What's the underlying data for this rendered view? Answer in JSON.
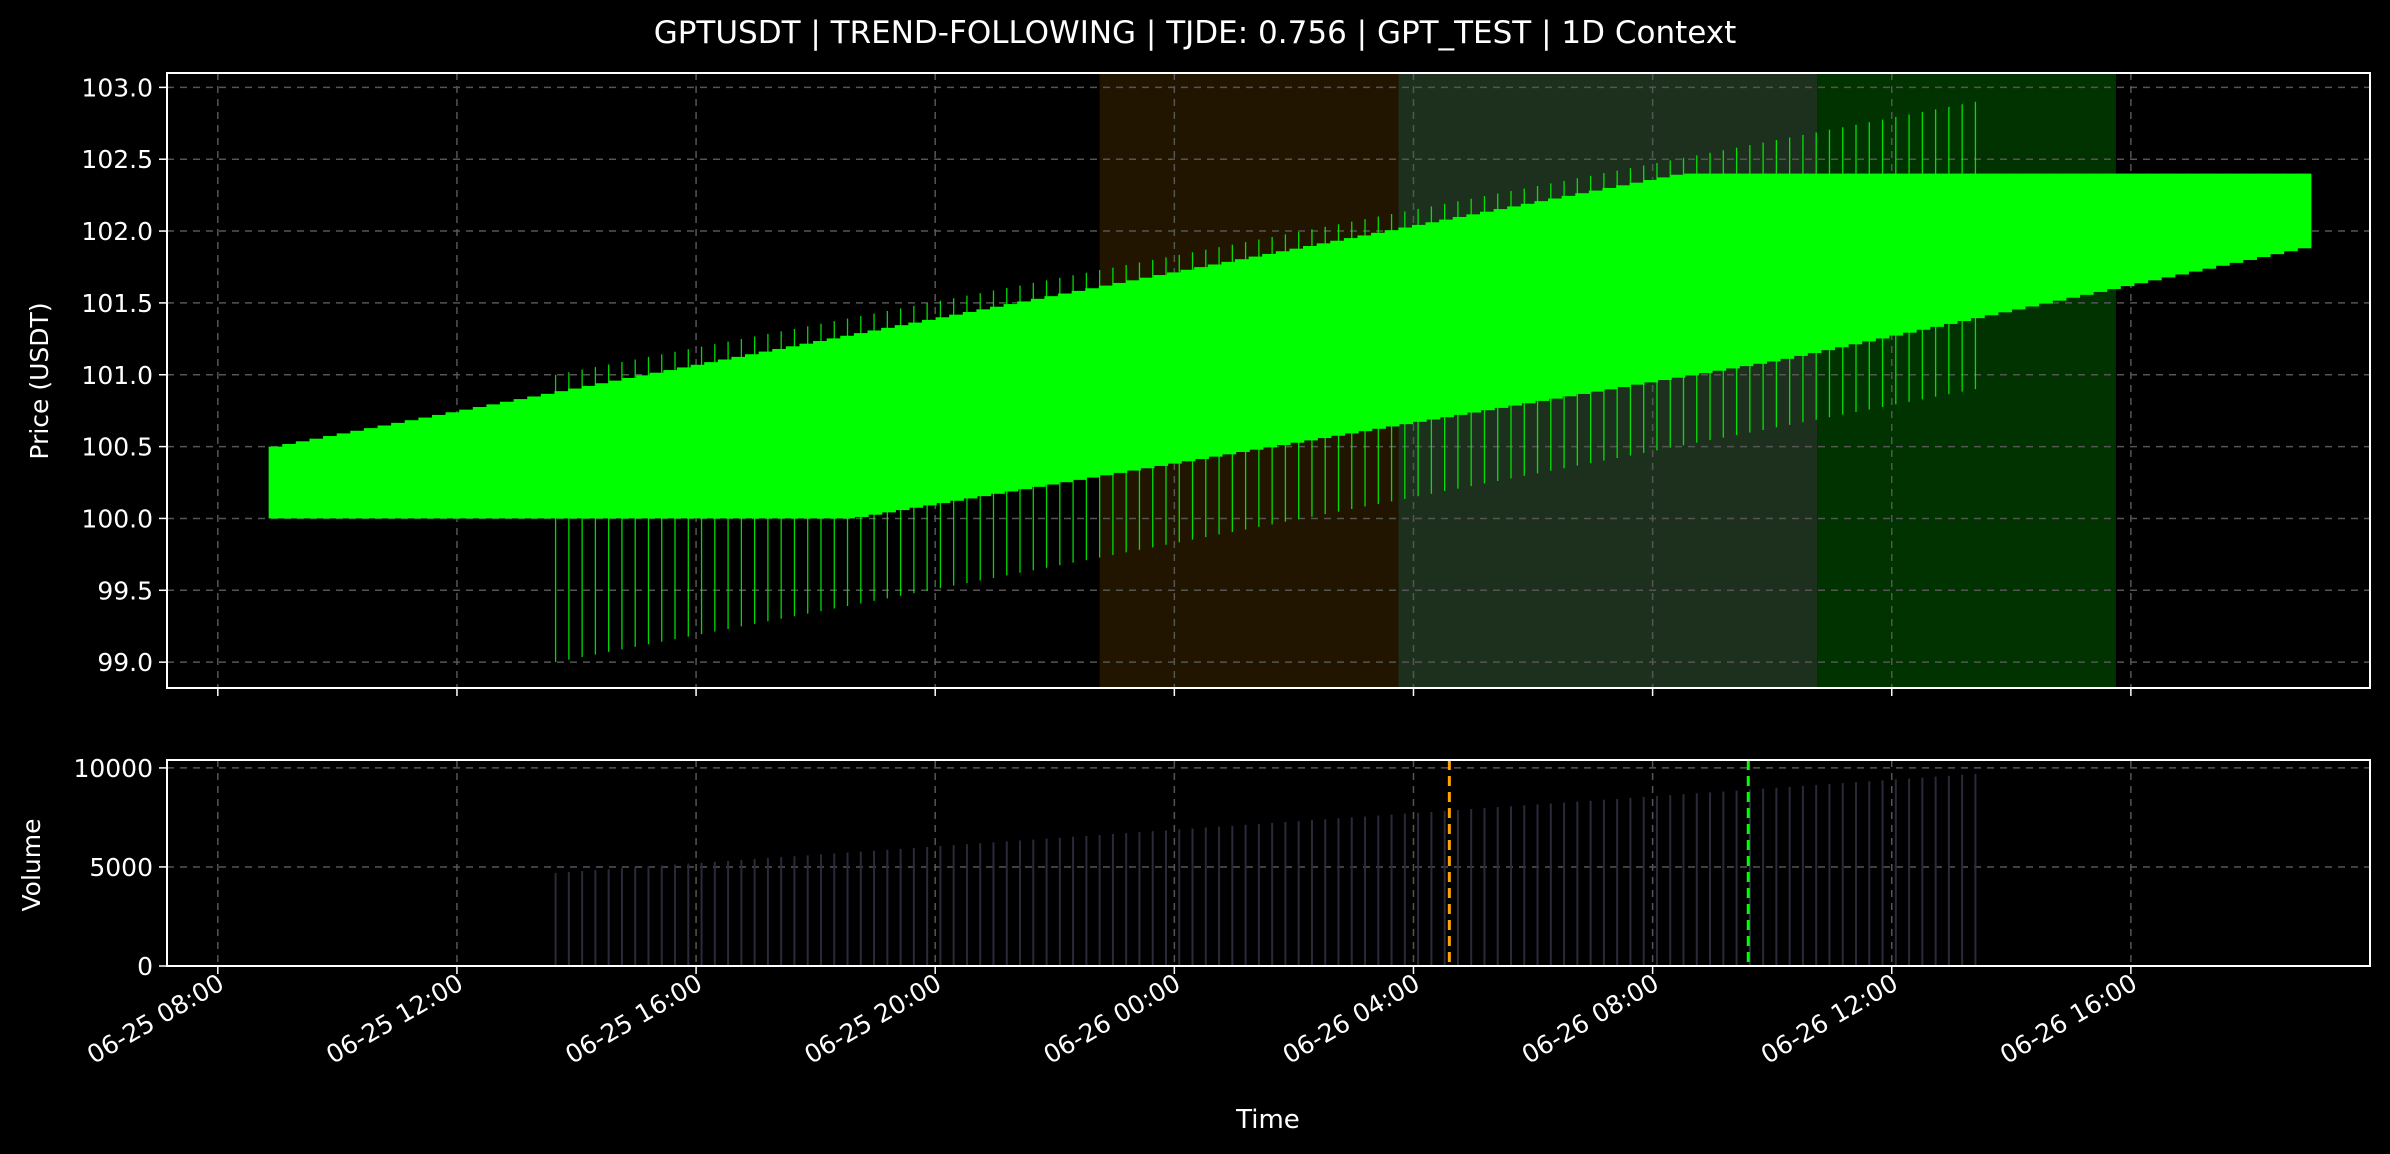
{
  "chart_data": {
    "type": "candlestick",
    "title": "GPTUSDT | TREND-FOLLOWING | TJDE: 0.756 | GPT_TEST | 1D Context",
    "x_tick_labels": [
      "06-25 08:00",
      "06-25 12:00",
      "06-25 16:00",
      "06-25 20:00",
      "06-26 00:00",
      "06-26 04:00",
      "06-26 08:00",
      "06-26 12:00",
      "06-26 16:00"
    ],
    "x_axis_label": "Time",
    "x_range_hours": [
      -0.85,
      36.0
    ],
    "price_panel": {
      "ylabel": "Price (USDT)",
      "ylim": [
        98.82,
        103.1
      ],
      "yticks": [
        99.0,
        99.5,
        100.0,
        100.5,
        101.0,
        101.5,
        102.0,
        102.5,
        103.0
      ],
      "candle_color": "#00ff00",
      "body": {
        "bottom": [
          [
            0.85,
            100.0
          ],
          [
            10.5,
            100.0
          ],
          [
            26.0,
            101.1
          ],
          [
            35.0,
            101.9
          ]
        ],
        "top": [
          [
            0.85,
            100.5
          ],
          [
            24.4,
            102.4
          ],
          [
            35.0,
            102.4
          ]
        ]
      },
      "wicks": {
        "start_hour": 5.65,
        "end_hour": 29.4,
        "count": 108,
        "low_start": 99.0,
        "low_end": 100.9,
        "high_start": 101.0,
        "high_end": 102.9
      },
      "shaded_regions": [
        {
          "from_hour": 14.75,
          "to_hour": 19.75,
          "color": "#ffa500",
          "opacity": 0.13
        },
        {
          "from_hour": 19.75,
          "to_hour": 26.75,
          "color": "#90ee90",
          "opacity": 0.2
        },
        {
          "from_hour": 26.75,
          "to_hour": 31.75,
          "color": "#00ff00",
          "opacity": 0.2
        }
      ]
    },
    "volume_panel": {
      "ylabel": "Volume",
      "ylim": [
        0,
        10400
      ],
      "yticks": [
        0,
        5000,
        10000
      ],
      "bars": {
        "start_hour": 5.65,
        "end_hour": 29.4,
        "count": 108,
        "v_start": 4700,
        "v_end": 9700,
        "color": "#2a2a3a"
      },
      "markers": [
        {
          "hour": 20.6,
          "color": "#ffa500"
        },
        {
          "hour": 25.6,
          "color": "#00ff00"
        }
      ]
    },
    "grid": true,
    "background": "#000000",
    "grid_color": "#555555"
  }
}
